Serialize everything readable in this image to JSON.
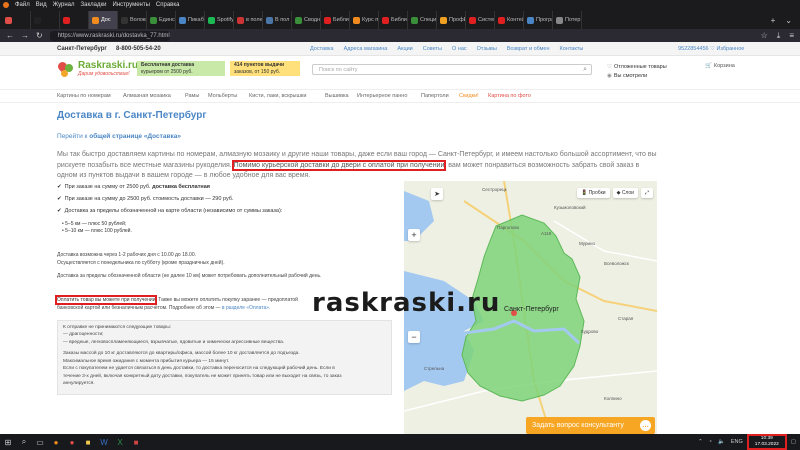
{
  "browser": {
    "menu": [
      "Файл",
      "Вид",
      "Журнал",
      "Закладки",
      "Инструменты",
      "Справка"
    ],
    "tabs": [
      {
        "label": "",
        "color": "#e14e47"
      },
      {
        "label": "",
        "color": "#222"
      },
      {
        "label": "",
        "color": "#e02020"
      },
      {
        "label": "Дос",
        "color": "#f08c1e",
        "active": true
      },
      {
        "label": "Волоки",
        "color": "#333"
      },
      {
        "label": "Единств",
        "color": "#3a8f3a"
      },
      {
        "label": "Пикабу",
        "color": "#4a86c5"
      },
      {
        "label": "Spotify",
        "color": "#1db954"
      },
      {
        "label": "в поле",
        "color": "#c33"
      },
      {
        "label": "В пол",
        "color": "#4a76a8"
      },
      {
        "label": "Сводн",
        "color": "#3a8f3a"
      },
      {
        "label": "Библиот",
        "color": "#e02020"
      },
      {
        "label": "Курс по",
        "color": "#f08c1e"
      },
      {
        "label": "Библиот",
        "color": "#e02020"
      },
      {
        "label": "Специ",
        "color": "#3a8f3a"
      },
      {
        "label": "ПрофЕ",
        "color": "#f0a020"
      },
      {
        "label": "Система",
        "color": "#e02020"
      },
      {
        "label": "Контей",
        "color": "#e02020"
      },
      {
        "label": "Програ",
        "color": "#4a86c5"
      },
      {
        "label": "Потер",
        "color": "#888"
      }
    ],
    "url": "https://www.raskraski.ru/dostavka_77.html"
  },
  "topline": {
    "city": "Санкт-Петербург",
    "phone": "8-800-505-54-20",
    "links": [
      "Доставка",
      "Адреса магазина",
      "Акции",
      "Советы",
      "О нас",
      "Отзывы",
      "Возврат и обмен",
      "Контакты"
    ],
    "right_phone": "9522854456",
    "favorites": "Избранное"
  },
  "header": {
    "logo_name": "Raskraski.ru",
    "logo_slogan": "Дарим удовольствие!",
    "promo1_title": "Бесплатная доставка",
    "promo1_text": "курьером от 2500 руб.",
    "promo2_title": "414 пунктов выдачи",
    "promo2_text": "заказов, от 150 руб.",
    "search_placeholder": "Поиск по сайту",
    "deferred": "Отложенные товары",
    "viewed": "Вы смотрели",
    "cart": "Корзина"
  },
  "catnav": [
    "Картины по номерам",
    "Алмазная мозаика",
    "Рамы",
    "Мольберты",
    "Кисти, лаки, вскрышки",
    "Вышивка",
    "Интерьерное панно",
    "Папертоли",
    "Скидки!",
    "Картина по фото"
  ],
  "content": {
    "title": "Доставка в г. Санкт-Петербург",
    "goto_prefix": "Перейти к ",
    "goto_link": "общей странице «Доставка»",
    "lead_before": "Мы так быстро доставляем картины по номерам, алмазную мозаику и другие наши товары, даже если ваш город — Санкт-Петербург, и имеем настолько большой ассортимент, что вы рискуете позабыть все местные магазины рукоделия. ",
    "lead_highlight": "Помимо курьерской доставки до двери с оплатой при получении",
    "lead_after": ", вам может понравиться возможность забрать свой заказ в одном из пунктов выдачи в вашем городе — в любое удобное для вас время.",
    "bullet1_text": "При заказе на сумму от 2500 руб. ",
    "bullet1_bold": "доставка бесплатная",
    "bullet2": "При заказе на сумму до 2500 руб. стоимость доставки — 290 руб.",
    "bullet3": "Доставка за пределы обозначенной на карте области (независимо от суммы заказа):",
    "sub1": "5–5 км — плюс 50 рублей;",
    "sub2": "5–10 км — плюс 100 рублей.",
    "para1": "Доставка возможна через 1-2 рабочих дня с 10.00 до 18.00.",
    "para2": "Осуществляется с понедельника по субботу (кроме праздничных дней).",
    "para3": "Доставка за пределы обозначенной области (не далее 10 км) может потребовать дополнительный рабочий день.",
    "pay_boxed": "Оплатить товар вы можете при получении",
    "pay_rest1": ". Также вы можете оплатить покупку заранее — предоплатой",
    "pay_rest2": "банковской картой или безналичным расчётом. Подробнее об этом — ",
    "pay_link": "в разделе «Оплата».",
    "box_lines": [
      "К отправке не принимаются следующие товары:",
      "— драгоценности;",
      "— вредные, легковоспламеняющиеся, взрывчатые, ядовитые и химически агрессивные вещества.",
      "",
      "Заказы массой до 10 кг доставляются до квартиры/офиса, массой более 10 кг доставляется до подъезда.",
      "Максимальное время ожидания с момента прибытия курьера — 15 минут.",
      "Если с покупателем не удается связаться в день доставки, то доставка переносится на следующий рабочий день. Если в",
      "течение 3-х дней, включая конкретный дату доставки, покупатель не может принять товар или не выходит на связь, то заказ",
      "аннулируется."
    ]
  },
  "map": {
    "btn_traffic": "Пробки",
    "btn_layers": "Слои",
    "zoom_in": "+",
    "zoom_out": "−",
    "labels": {
      "sestroretsk": "Сестрорецк",
      "kuzmolovsky": "Кузьмоловский",
      "murino": "Мурино",
      "vsevolozhsk": "Всеволожск",
      "spb": "Санкт-Петербург",
      "kudrovo": "Кудрово",
      "staraya": "Старая",
      "strelna": "Стрельна",
      "pargolovo": "Парголово",
      "kolpino": "Колпино",
      "road_a118": "A118"
    },
    "yandex_link": "Открыть в Яндекс.Картах",
    "zone_color": "#7ed37a",
    "water_color": "#a4c9f0"
  },
  "watermark": "raskraski.ru",
  "consult": "Задать вопрос консультанту",
  "taskbar": {
    "lang": "ENG",
    "time": "10:39",
    "date": "17.03.2022"
  }
}
